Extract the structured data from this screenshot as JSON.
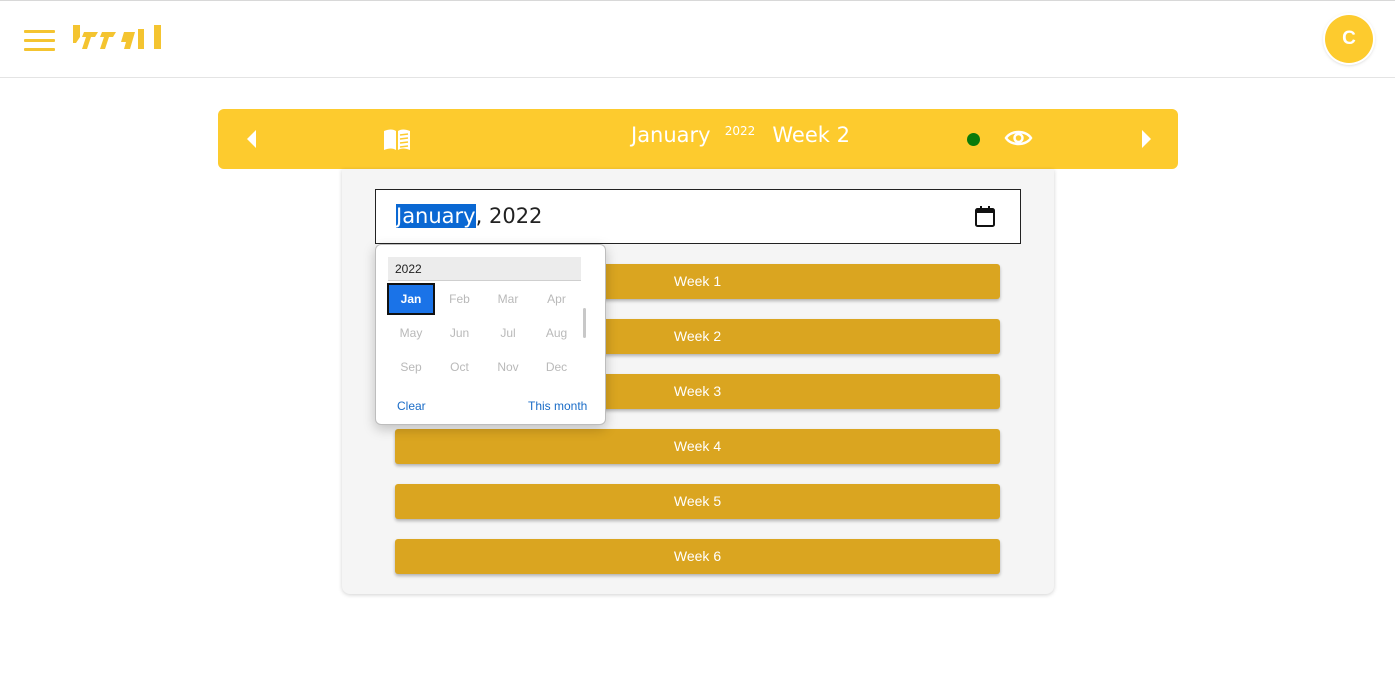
{
  "header": {
    "menu_icon": "hamburger-menu-icon",
    "logo_icon": "brand-logo",
    "avatar_initial": "C"
  },
  "week_nav": {
    "month": "January",
    "year": "2022",
    "week": "Week 2",
    "status_color": "#0a7a0a",
    "prev_icon": "caret-left-icon",
    "book_icon": "book-icon",
    "eye_icon": "eye-icon",
    "next_icon": "caret-right-icon"
  },
  "month_input": {
    "selected_part": "January",
    "rest": ", 2022",
    "calendar_icon": "calendar-icon"
  },
  "weeks": [
    "Week 1",
    "Week 2",
    "Week 3",
    "Week 4",
    "Week 5",
    "Week 6"
  ],
  "month_picker": {
    "year": "2022",
    "months": [
      "Jan",
      "Feb",
      "Mar",
      "Apr",
      "May",
      "Jun",
      "Jul",
      "Aug",
      "Sep",
      "Oct",
      "Nov",
      "Dec"
    ],
    "selected": "Jan",
    "clear_label": "Clear",
    "this_month_label": "This month"
  },
  "colors": {
    "brand_yellow": "#fdcb2e",
    "week_button": "#daa520",
    "selection_blue": "#1a73e8"
  }
}
